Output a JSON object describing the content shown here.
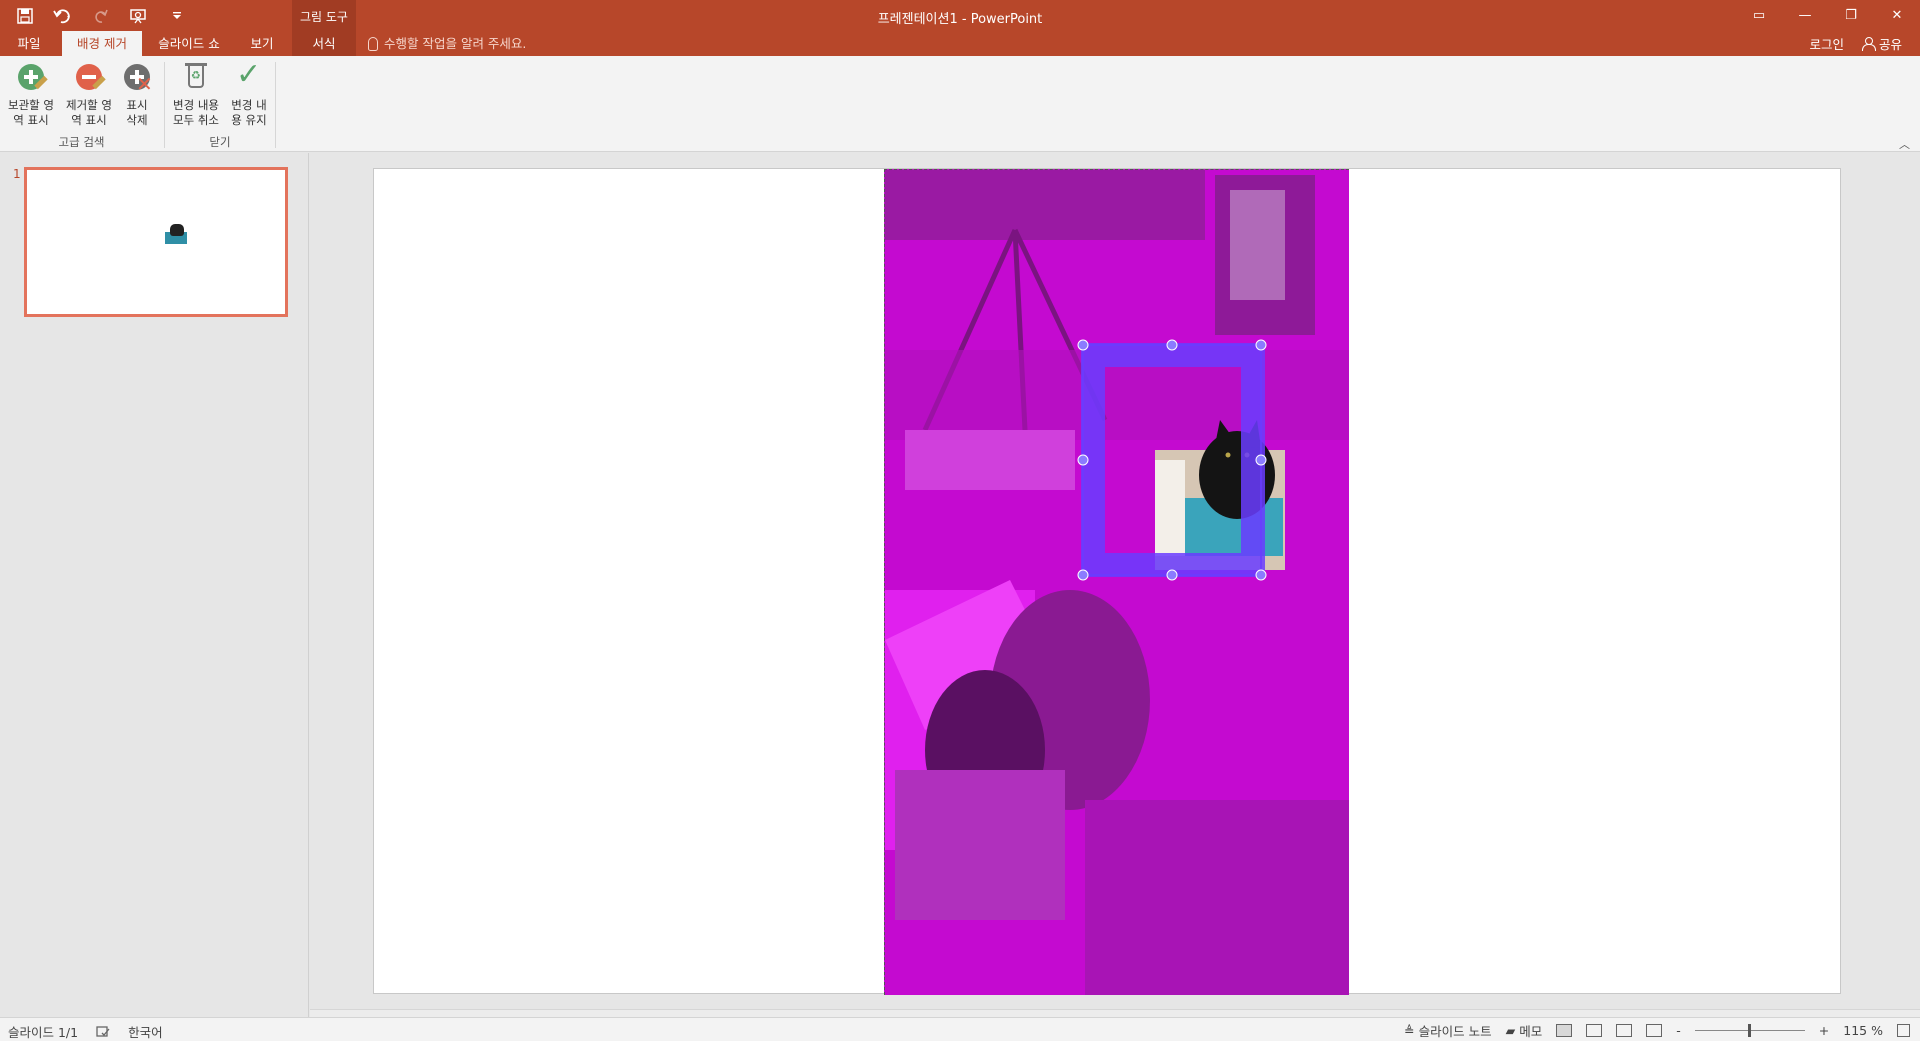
{
  "app": {
    "title": "프레젠테이션1 - PowerPoint",
    "context_group": "그림 도구"
  },
  "qat": {
    "icons": [
      "save-icon",
      "undo-icon",
      "redo-icon",
      "present-from-beginning-icon",
      "customize-qat-icon"
    ]
  },
  "window_controls": {
    "ribbon_display_options": "▭",
    "minimize": "—",
    "maximize": "❐",
    "close": "✕"
  },
  "tabs": [
    {
      "label": "파일",
      "active": false
    },
    {
      "label": "배경 제거",
      "active": true
    },
    {
      "label": "슬라이드 쇼",
      "active": false
    },
    {
      "label": "보기",
      "active": false
    },
    {
      "label": "서식",
      "active": false
    }
  ],
  "tell_me": "수행할 작업을 알려 주세요.",
  "account": {
    "login": "로그인",
    "share": "공유"
  },
  "ribbon": {
    "groups": [
      {
        "label": "고급 검색",
        "buttons": [
          {
            "label": "보관할 영\n역 표시",
            "icon": "mark-areas-to-keep-icon"
          },
          {
            "label": "제거할 영\n역 표시",
            "icon": "mark-areas-to-remove-icon"
          },
          {
            "label": "표시\n삭제",
            "icon": "delete-mark-icon"
          }
        ]
      },
      {
        "label": "닫기",
        "buttons": [
          {
            "label": "변경 내용\n모두 취소",
            "icon": "discard-all-changes-icon"
          },
          {
            "label": "변경 내\n용 유지",
            "icon": "keep-changes-icon"
          }
        ]
      }
    ]
  },
  "thumbnails": [
    {
      "number": "1"
    }
  ],
  "status": {
    "slide": "슬라이드 1/1",
    "language": "한국어",
    "notes": "슬라이드 노트",
    "comments": "메모",
    "zoom_minus": "-",
    "zoom_plus": "+",
    "zoom": "115 %"
  },
  "colors": {
    "accent": "#b7472a",
    "removal_overlay": "#c40ad0",
    "marquee": "#6a3cff"
  }
}
